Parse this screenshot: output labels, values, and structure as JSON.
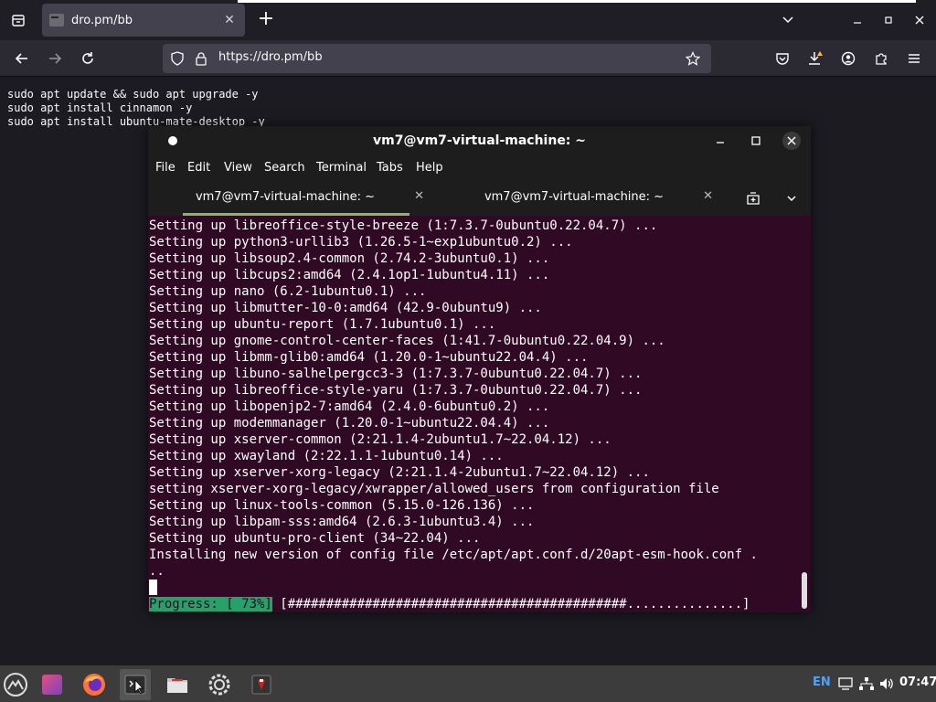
{
  "browser": {
    "tab_title": "dro.pm/bb",
    "url": "https://dro.pm/bb",
    "page_lines": [
      "sudo apt update && sudo apt upgrade -y",
      "sudo apt install cinnamon -y",
      "sudo apt install ubuntu-mate-desktop -y"
    ]
  },
  "terminal": {
    "title": "vm7@vm7-virtual-machine: ~",
    "menu": [
      "File",
      "Edit",
      "View",
      "Search",
      "Terminal",
      "Tabs",
      "Help"
    ],
    "tabs": [
      {
        "label": "vm7@vm7-virtual-machine: ~",
        "active": true
      },
      {
        "label": "vm7@vm7-virtual-machine: ~",
        "active": false
      }
    ],
    "lines": [
      "Setting up libreoffice-style-breeze (1:7.3.7-0ubuntu0.22.04.7) ...",
      "Setting up python3-urllib3 (1.26.5-1~exp1ubuntu0.2) ...",
      "Setting up libsoup2.4-common (2.74.2-3ubuntu0.1) ...",
      "Setting up libcups2:amd64 (2.4.1op1-1ubuntu4.11) ...",
      "Setting up nano (6.2-1ubuntu0.1) ...",
      "Setting up libmutter-10-0:amd64 (42.9-0ubuntu9) ...",
      "Setting up ubuntu-report (1.7.1ubuntu0.1) ...",
      "Setting up gnome-control-center-faces (1:41.7-0ubuntu0.22.04.9) ...",
      "Setting up libmm-glib0:amd64 (1.20.0-1~ubuntu22.04.4) ...",
      "Setting up libuno-salhelpergcc3-3 (1:7.3.7-0ubuntu0.22.04.7) ...",
      "Setting up libreoffice-style-yaru (1:7.3.7-0ubuntu0.22.04.7) ...",
      "Setting up libopenjp2-7:amd64 (2.4.0-6ubuntu0.2) ...",
      "Setting up modemmanager (1.20.0-1~ubuntu22.04.4) ...",
      "Setting up xserver-common (2:21.1.4-2ubuntu1.7~22.04.12) ...",
      "Setting up xwayland (2:22.1.1-1ubuntu0.14) ...",
      "Setting up xserver-xorg-legacy (2:21.1.4-2ubuntu1.7~22.04.12) ...",
      "setting xserver-xorg-legacy/xwrapper/allowed_users from configuration file",
      "Setting up linux-tools-common (5.15.0-126.136) ...",
      "Setting up libpam-sss:amd64 (2.6.3-1ubuntu3.4) ...",
      "Setting up ubuntu-pro-client (34~22.04) ...",
      "Installing new version of config file /etc/apt/apt.conf.d/20apt-esm-hook.conf .",
      ".."
    ],
    "progress_label": "Progress: [ 73%]",
    "progress_bar": " [############################################...............]",
    "progress_percent": 73
  },
  "taskbar": {
    "language": "EN",
    "clock": "07:47"
  },
  "colors": {
    "terminal_bg": "#300a24",
    "progress_green": "#26a269",
    "tab_underline": "#8ab661"
  }
}
